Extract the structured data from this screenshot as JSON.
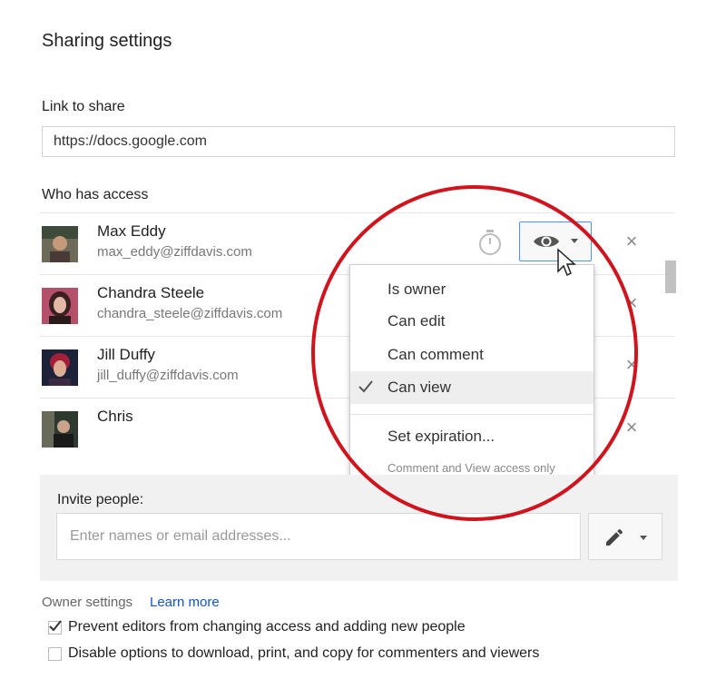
{
  "dialog": {
    "title": "Sharing settings"
  },
  "link": {
    "label": "Link to share",
    "value": "https://docs.google.com"
  },
  "access": {
    "label": "Who has access",
    "people": [
      {
        "name": "Max Eddy",
        "email": "max_eddy@ziffdavis.com"
      },
      {
        "name": "Chandra Steele",
        "email": "chandra_steele@ziffdavis.com"
      },
      {
        "name": "Jill Duffy",
        "email": "jill_duffy@ziffdavis.com"
      },
      {
        "name": "Chris",
        "email": ""
      }
    ],
    "remove_icon": "×"
  },
  "permission_button": {
    "icon": "eye-icon",
    "selected": "Can view"
  },
  "permission_menu": {
    "items": [
      "Is owner",
      "Can edit",
      "Can comment",
      "Can view"
    ],
    "selected_index": 3,
    "expiration": "Set expiration...",
    "note": "Comment and View access only"
  },
  "invite": {
    "label": "Invite people:",
    "placeholder": "Enter names or email addresses..."
  },
  "owner_settings": {
    "label": "Owner settings",
    "learn_more": "Learn more",
    "options": [
      {
        "label": "Prevent editors from changing access and adding new people",
        "checked": true
      },
      {
        "label": "Disable options to download, print, and copy for commenters and viewers",
        "checked": false
      }
    ]
  },
  "colors": {
    "accent": "#4d90fe",
    "link": "#1155cc",
    "annotation": "#d0141d"
  }
}
